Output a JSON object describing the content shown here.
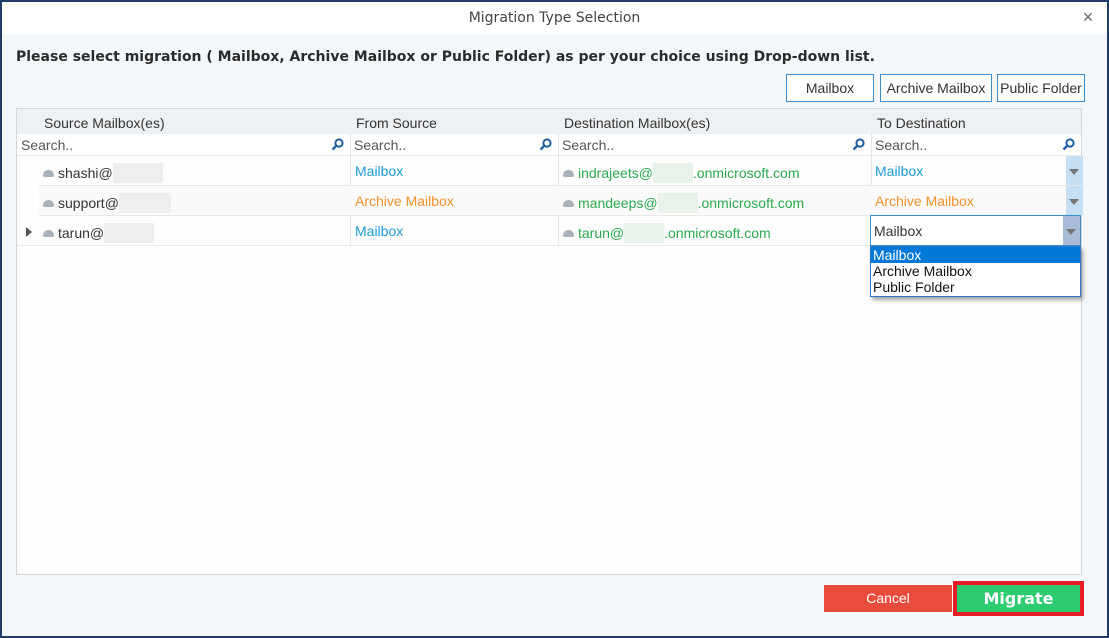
{
  "window": {
    "title": "Migration Type Selection",
    "close_icon": "close-icon"
  },
  "instruction": "Please select migration ( Mailbox, Archive Mailbox or Public Folder) as per your choice using Drop-down list.",
  "type_buttons": {
    "mailbox": "Mailbox",
    "archive": "Archive Mailbox",
    "public": "Public Folder"
  },
  "grid": {
    "columns": [
      {
        "label": "Source Mailbox(es)"
      },
      {
        "label": "From Source"
      },
      {
        "label": "Destination Mailbox(es)"
      },
      {
        "label": "To Destination"
      }
    ],
    "search_placeholder": "Search..",
    "rows": [
      {
        "source": "shashi@",
        "from": "Mailbox",
        "from_type": "mailbox",
        "dest_user": "indrajeets@",
        "dest_domain": ".onmicrosoft.com",
        "to": "Mailbox",
        "to_type": "mailbox"
      },
      {
        "source": "support@",
        "from": "Archive Mailbox",
        "from_type": "archive",
        "dest_user": "mandeeps@",
        "dest_domain": ".onmicrosoft.com",
        "to": "Archive Mailbox",
        "to_type": "archive"
      },
      {
        "source": "tarun@",
        "from": "Mailbox",
        "from_type": "mailbox",
        "dest_user": "tarun@",
        "dest_domain": ".onmicrosoft.com",
        "to": "Mailbox",
        "to_type": "mailbox"
      }
    ],
    "active_dropdown": {
      "value": "Mailbox",
      "options": [
        "Mailbox",
        "Archive Mailbox",
        "Public Folder"
      ],
      "selected_index": 0
    }
  },
  "footer": {
    "cancel": "Cancel",
    "migrate": "Migrate"
  },
  "colors": {
    "mailbox_text": "#1e9ad6",
    "archive_text": "#f0902c",
    "destination_text": "#2aa94d",
    "cancel_bg": "#e94b3c",
    "migrate_bg": "#2ecc71",
    "migrate_highlight": "#e81c24",
    "window_border": "#1f3d66"
  }
}
